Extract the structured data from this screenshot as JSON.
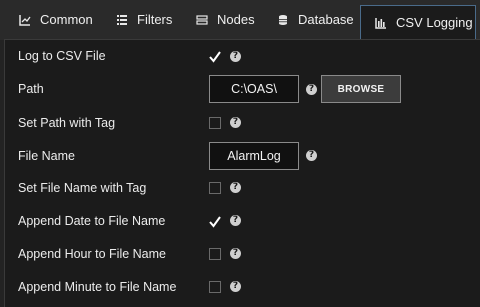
{
  "tabs": [
    {
      "label": "Common",
      "icon": "chart-icon"
    },
    {
      "label": "Filters",
      "icon": "filter-list-icon"
    },
    {
      "label": "Nodes",
      "icon": "nodes-icon"
    },
    {
      "label": "Database",
      "icon": "database-icon"
    },
    {
      "label": "CSV Logging",
      "icon": "csv-chart-icon",
      "active": true
    }
  ],
  "form": {
    "log_to_csv": {
      "label": "Log to CSV File",
      "checked": true
    },
    "path": {
      "label": "Path",
      "value": "C:\\OAS\\",
      "browse_label": "BROWSE"
    },
    "set_path_with_tag": {
      "label": "Set Path with Tag",
      "checked": false
    },
    "file_name": {
      "label": "File Name",
      "value": "AlarmLog"
    },
    "set_file_name_with_tag": {
      "label": "Set File Name with Tag",
      "checked": false
    },
    "append_date": {
      "label": "Append Date to File Name",
      "checked": true
    },
    "append_hour": {
      "label": "Append Hour to File Name",
      "checked": false
    },
    "append_minute": {
      "label": "Append Minute to File Name",
      "checked": false
    }
  },
  "help_glyph": "?",
  "colors": {
    "background": "#1b1b1b",
    "tabbar": "#2a2a2a",
    "active_tab_border": "#4a6b8a",
    "checkmark": "#ffffff"
  }
}
